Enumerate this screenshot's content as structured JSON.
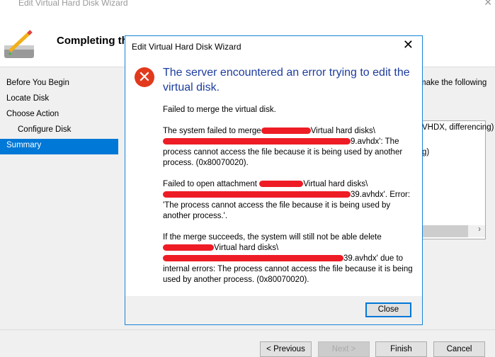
{
  "wizard": {
    "title": "Edit Virtual Hard Disk Wizard",
    "heading": "Completing th",
    "sidebar": [
      {
        "label": "Before You Begin"
      },
      {
        "label": "Locate Disk"
      },
      {
        "label": "Choose Action"
      },
      {
        "label": "Configure Disk"
      },
      {
        "label": "Summary",
        "selected": true
      }
    ],
    "right_text": "make the following",
    "summary_line1": "VHDX, differencing)",
    "summary_line2": "g)",
    "buttons": {
      "previous": "< Previous",
      "next": "Next >",
      "finish": "Finish",
      "cancel": "Cancel"
    }
  },
  "dialog": {
    "title": "Edit Virtual Hard Disk Wizard",
    "main_instruction": "The server encountered an error trying to edit the virtual disk.",
    "p1": "Failed to merge the virtual disk.",
    "p2a": "The system failed to merge",
    "p2b": "Virtual hard disks\\",
    "p2c": "9.avhdx': The process cannot access the file because it is being used by another process. (0x80070020).",
    "p3a": "Failed to open attachment",
    "p3b": "Virtual hard disks\\",
    "p3c": "39.avhdx'. Error: 'The process cannot access the file because it is being used by another process.'.",
    "p4a": "If the merge succeeds, the system will still not be able delete",
    "p4b": "Virtual hard disks\\",
    "p4c": "39.avhdx' due to internal errors: The process cannot access the file because it is being used by another process. (0x80070020).",
    "close_label": "Close"
  },
  "colors": {
    "accent": "#0078d7",
    "error": "#e2391c",
    "redaction": "#ee1c25",
    "instruction": "#1e3d9e"
  }
}
